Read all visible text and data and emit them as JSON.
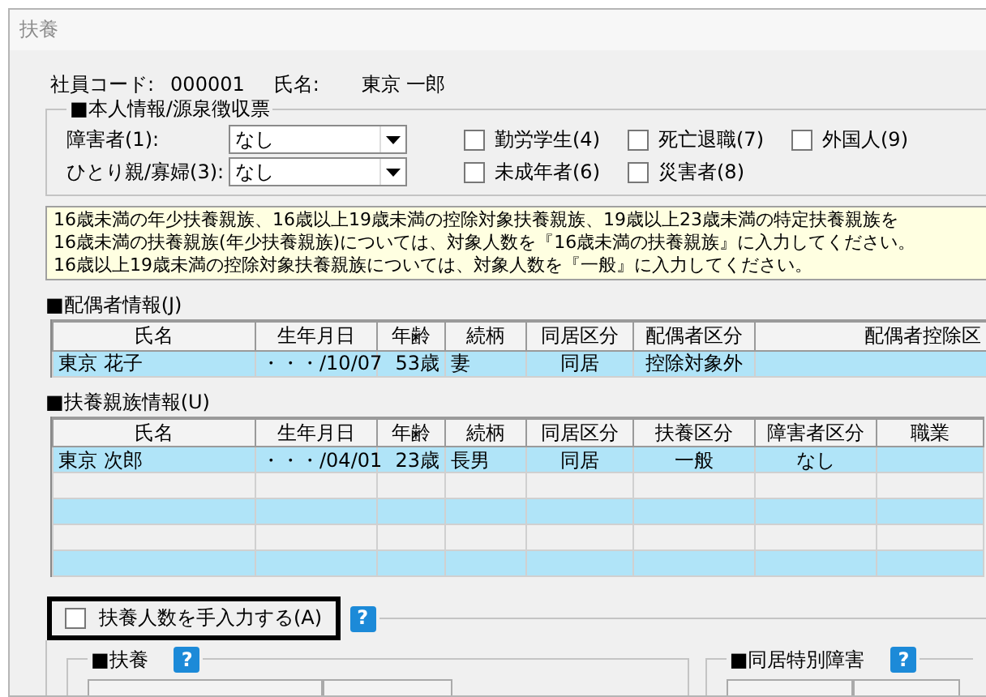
{
  "window": {
    "title": "扶養"
  },
  "employee": {
    "code_label": "社員コード:",
    "code": "000001",
    "name_label": "氏名:",
    "name": "東京 一郎"
  },
  "personal": {
    "title": "■本人情報/源泉徴収票",
    "selects": [
      {
        "label": "障害者(1):",
        "value": "なし"
      },
      {
        "label": "ひとり親/寡婦(3):",
        "value": "なし"
      }
    ],
    "checkbox_rows": [
      [
        {
          "label": "勤労学生(4)",
          "checked": false
        },
        {
          "label": "死亡退職(7)",
          "checked": false
        },
        {
          "label": "外国人(9)",
          "checked": false
        }
      ],
      [
        {
          "label": "未成年者(6)",
          "checked": false
        },
        {
          "label": "災害者(8)",
          "checked": false
        }
      ]
    ]
  },
  "notice": [
    "16歳未満の年少扶養親族、16歳以上19歳未満の控除対象扶養親族、19歳以上23歳未満の特定扶養親族を",
    "16歳未満の扶養親族(年少扶養親族)については、対象人数を『16歳未満の扶養親族』に入力してください。",
    "16歳以上19歳未満の控除対象扶養親族については、対象人数を『一般』に入力してください。"
  ],
  "spouse": {
    "title": "■配偶者情報(J)",
    "columns": [
      "氏名",
      "生年月日",
      "年齢",
      "続柄",
      "同居区分",
      "配偶者区分",
      "配偶者控除区"
    ],
    "rows": [
      {
        "cells": [
          "東京 花子",
          "・・・/10/07",
          "53歳",
          "妻",
          "同居",
          "控除対象外"
        ]
      }
    ]
  },
  "dependents": {
    "title": "■扶養親族情報(U)",
    "columns": [
      "氏名",
      "生年月日",
      "年齢",
      "続柄",
      "同居区分",
      "扶養区分",
      "障害者区分",
      "職業"
    ],
    "rows": [
      {
        "cells": [
          "東京 次郎",
          "・・・/04/01",
          "23歳",
          "長男",
          "同居",
          "一般",
          "なし"
        ]
      }
    ]
  },
  "manual": {
    "label": "扶養人数を手入力する(A)",
    "checked": false,
    "help": "?"
  },
  "groups": [
    {
      "title": "■扶養",
      "help": "?"
    },
    {
      "title": "■同居特別障害",
      "help": "?"
    }
  ]
}
